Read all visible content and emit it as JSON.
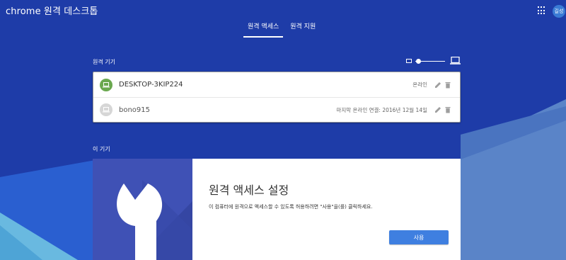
{
  "app": {
    "title": "chrome 원격 데스크톱"
  },
  "header": {
    "avatar_text": "길성"
  },
  "tabs": [
    {
      "label": "원격 액세스",
      "active": true
    },
    {
      "label": "원격 지원",
      "active": false
    }
  ],
  "remote_devices": {
    "label": "원격 기기",
    "hosts": [
      {
        "name": "DESKTOP-3KIP224",
        "status": "온라인",
        "online": true
      },
      {
        "name": "bono915",
        "status": "마지막 온라인 연결: 2016년 12월 14일",
        "online": false
      }
    ]
  },
  "this_device": {
    "label": "이 기기",
    "title": "원격 액세스 설정",
    "description": "이 컴퓨터에 원격으로 액세스할 수 있도록 허용하려면 \"사용\"을(를) 클릭하세요.",
    "enable_button": "사용"
  },
  "colors": {
    "background": "#1e3ca8",
    "accent_button": "#3f7fe0",
    "online": "#6aa84f",
    "offline": "#d6d6d6",
    "art_panel": "#3f51b5"
  }
}
